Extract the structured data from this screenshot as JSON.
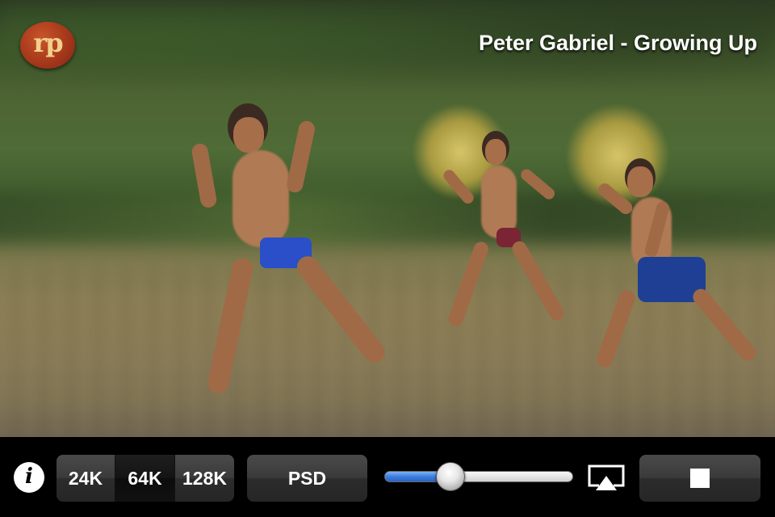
{
  "track": {
    "title": "Peter Gabriel - Growing Up"
  },
  "logo": {
    "text": "rp"
  },
  "controls": {
    "info_label": "i",
    "bitrate_options": [
      "24K",
      "64K",
      "128K"
    ],
    "bitrate_selected": "64K",
    "psd_label": "PSD",
    "volume": {
      "level": 0.35
    },
    "airplay_icon": "airplay-icon",
    "stop_icon": "stop-icon"
  },
  "colors": {
    "volume_fill": "#3b7fe0",
    "logo_bg": "#a3361a",
    "logo_text": "#f2d08c"
  }
}
